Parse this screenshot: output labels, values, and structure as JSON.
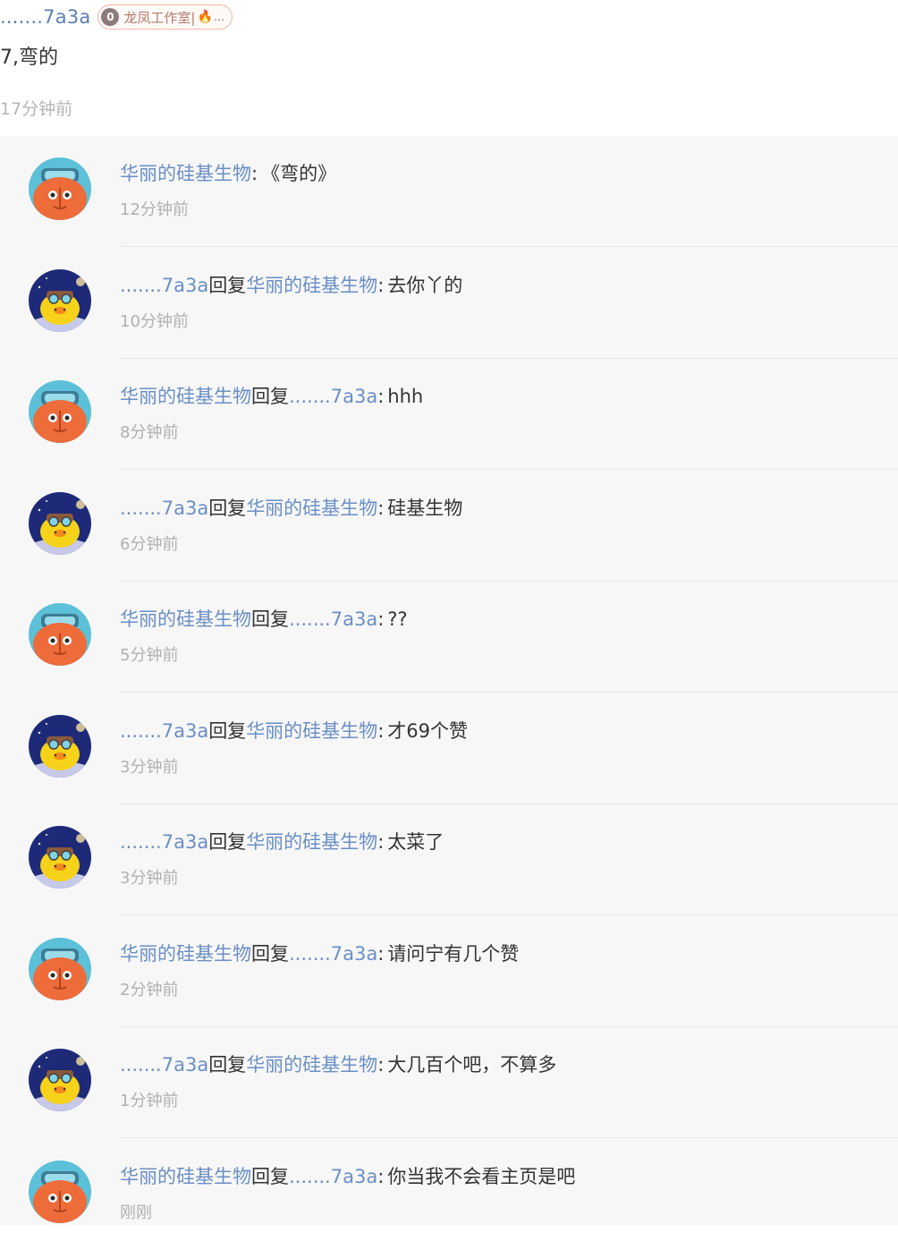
{
  "comment": {
    "author": ".......7a3a",
    "badge": {
      "level": "0",
      "name": "龙凤工作室|",
      "suffix": "..."
    },
    "text": "7,弯的",
    "time": "17分钟前"
  },
  "colors": {
    "link": "#6a8fc4",
    "time": "#b0b0b0",
    "panel_bg": "#f7f7f8"
  },
  "replies": [
    {
      "avatar": "orange-robot-avatar",
      "from": "华丽的硅基生物",
      "reply_word": "",
      "to": "",
      "sep": ":",
      "text": "《弯的》",
      "time": "12分钟前"
    },
    {
      "avatar": "yellow-bird-avatar",
      "from": ".......7a3a",
      "reply_word": "回复",
      "to": "华丽的硅基生物",
      "sep": ":",
      "text": "去你丫的",
      "time": "10分钟前"
    },
    {
      "avatar": "orange-robot-avatar",
      "from": "华丽的硅基生物",
      "reply_word": "回复",
      "to": ".......7a3a",
      "sep": ":",
      "text": "hhh",
      "time": "8分钟前"
    },
    {
      "avatar": "yellow-bird-avatar",
      "from": ".......7a3a",
      "reply_word": "回复",
      "to": "华丽的硅基生物",
      "sep": ":",
      "text": "硅基生物",
      "time": "6分钟前"
    },
    {
      "avatar": "orange-robot-avatar",
      "from": "华丽的硅基生物",
      "reply_word": "回复",
      "to": ".......7a3a",
      "sep": ":",
      "text": "??",
      "time": "5分钟前"
    },
    {
      "avatar": "yellow-bird-avatar",
      "from": ".......7a3a",
      "reply_word": "回复",
      "to": "华丽的硅基生物",
      "sep": ":",
      "text": "才69个赞",
      "time": "3分钟前"
    },
    {
      "avatar": "yellow-bird-avatar",
      "from": ".......7a3a",
      "reply_word": "回复",
      "to": "华丽的硅基生物",
      "sep": ":",
      "text": "太菜了",
      "time": "3分钟前"
    },
    {
      "avatar": "orange-robot-avatar",
      "from": "华丽的硅基生物",
      "reply_word": "回复",
      "to": ".......7a3a",
      "sep": ":",
      "text": "请问宁有几个赞",
      "time": "2分钟前"
    },
    {
      "avatar": "yellow-bird-avatar",
      "from": ".......7a3a",
      "reply_word": "回复",
      "to": "华丽的硅基生物",
      "sep": ":",
      "text": "大几百个吧，不算多",
      "time": "1分钟前"
    },
    {
      "avatar": "orange-robot-avatar",
      "from": "华丽的硅基生物",
      "reply_word": "回复",
      "to": ".......7a3a",
      "sep": ":",
      "text": "你当我不会看主页是吧",
      "time": "刚刚"
    }
  ]
}
